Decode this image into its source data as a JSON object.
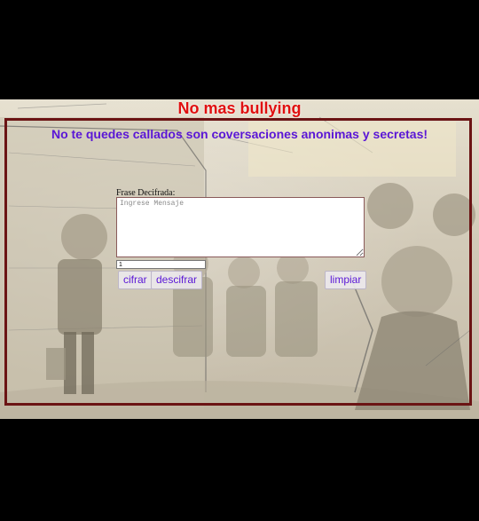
{
  "page": {
    "title": "No mas bullying",
    "subtitle": "No te quedes callados son coversaciones anonimas y secretas!"
  },
  "form": {
    "label": "Frase Decifrada:",
    "message_placeholder": "Ingrese Mensaje",
    "message_value": "",
    "key_value": "1"
  },
  "buttons": {
    "encrypt": "cifrar",
    "decrypt": "descifrar",
    "clear": "limpiar"
  },
  "colors": {
    "title": "#e01010",
    "subtitle": "#5a16d6",
    "frame": "#6b1414"
  }
}
